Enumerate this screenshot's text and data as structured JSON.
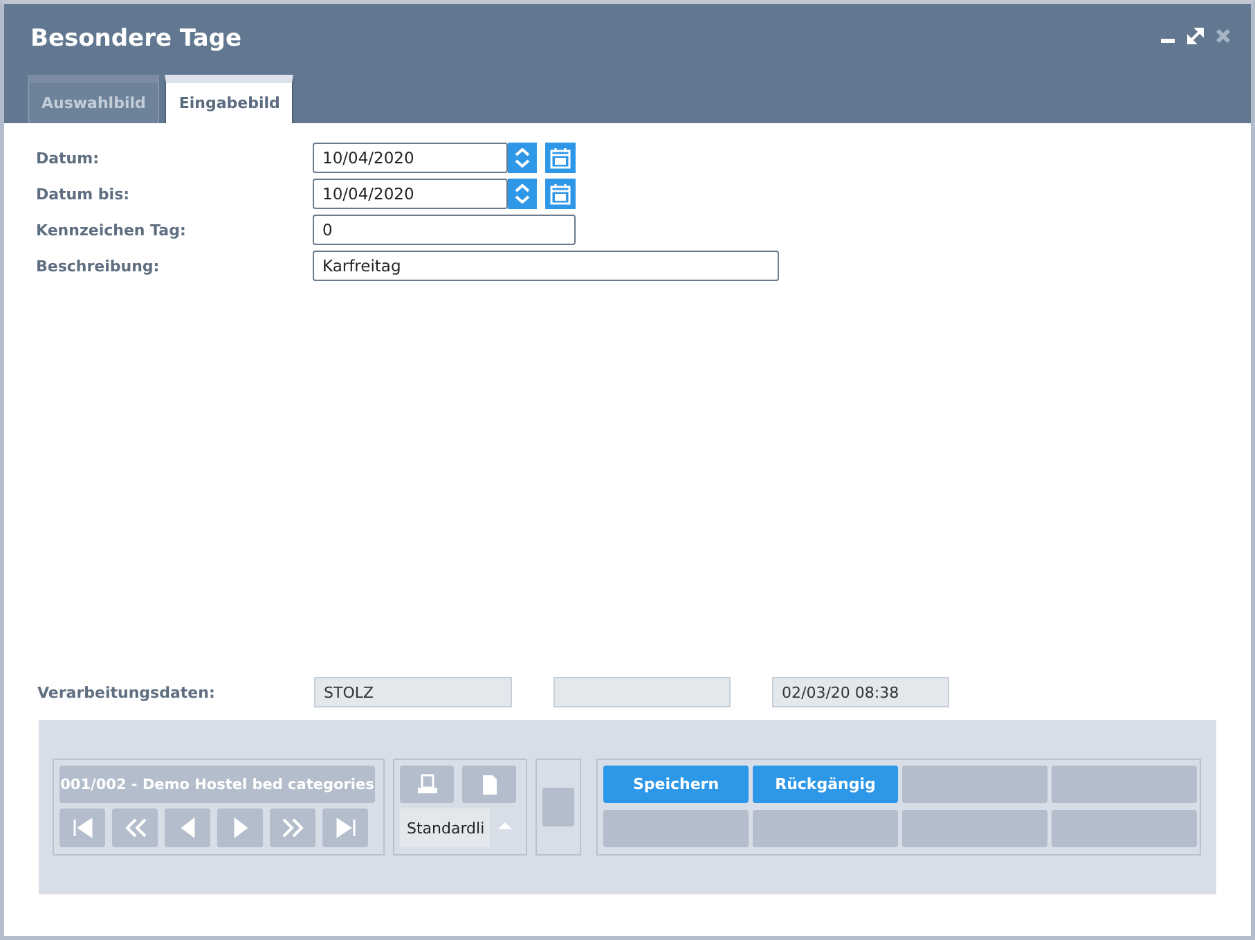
{
  "window": {
    "title": "Besondere Tage"
  },
  "tabs": [
    {
      "label": "Auswahlbild",
      "selected": false
    },
    {
      "label": "Eingabebild",
      "selected": true
    }
  ],
  "fields": [
    {
      "label": "Datum:",
      "value": "10/04/2020",
      "kind": "date"
    },
    {
      "label": "Datum bis:",
      "value": "10/04/2020",
      "kind": "date"
    },
    {
      "label": "Kennzeichen Tag:",
      "value": "0",
      "kind": "short"
    },
    {
      "label": "Beschreibung:",
      "value": "Karfreitag",
      "kind": "long"
    }
  ],
  "processing": {
    "label": "Verarbeitungsdaten:",
    "user": "STOLZ",
    "timestamp": "02/03/20 08:38"
  },
  "footer": {
    "record": "001/002 - Demo Hostel bed categories",
    "layout_select": "Standardli",
    "actions": [
      {
        "label": "Speichern"
      },
      {
        "label": "Rückgängig"
      }
    ]
  }
}
